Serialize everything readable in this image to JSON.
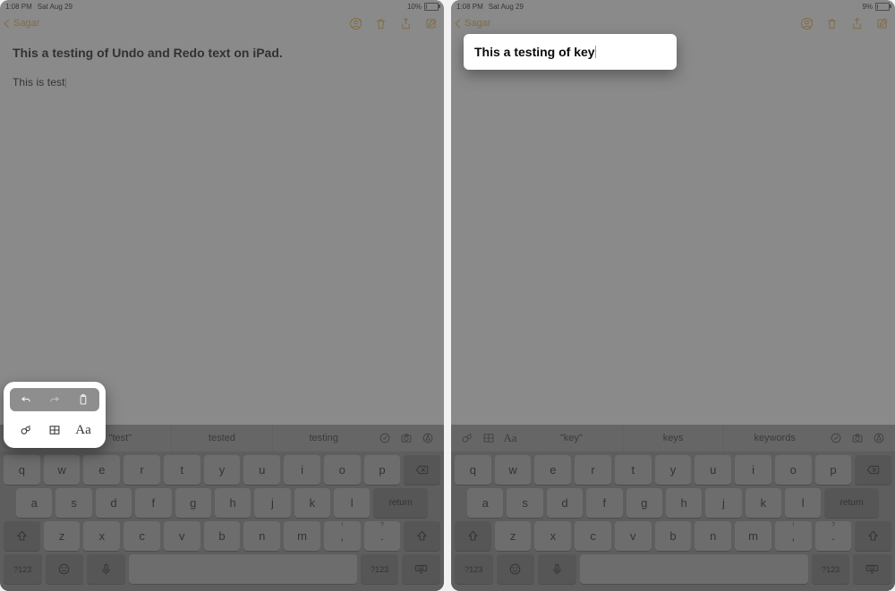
{
  "left": {
    "status": {
      "time": "1:08 PM",
      "date": "Sat Aug 29",
      "battery_pct": "10%"
    },
    "nav": {
      "back_label": "Sagar"
    },
    "note": {
      "title": "This a testing of Undo and Redo text on iPad.",
      "body": "This is test"
    },
    "suggestions": [
      "\"test\"",
      "tested",
      "testing"
    ]
  },
  "right": {
    "status": {
      "time": "1:08 PM",
      "date": "Sat Aug 29",
      "battery_pct": "9%"
    },
    "nav": {
      "back_label": "Sagar"
    },
    "note": {
      "title": "This a testing of key"
    },
    "suggestions": [
      "\"key\"",
      "keys",
      "keywords"
    ]
  },
  "keyboard": {
    "row1": [
      "q",
      "w",
      "e",
      "r",
      "t",
      "y",
      "u",
      "i",
      "o",
      "p"
    ],
    "row2": [
      "a",
      "s",
      "d",
      "f",
      "g",
      "h",
      "j",
      "k",
      "l"
    ],
    "row3": [
      "z",
      "x",
      "c",
      "v",
      "b",
      "n",
      "m"
    ],
    "row3_punct": [
      "!\n,",
      "?\n."
    ],
    "numkey": "?123",
    "return": "return",
    "aa": "Aa"
  }
}
